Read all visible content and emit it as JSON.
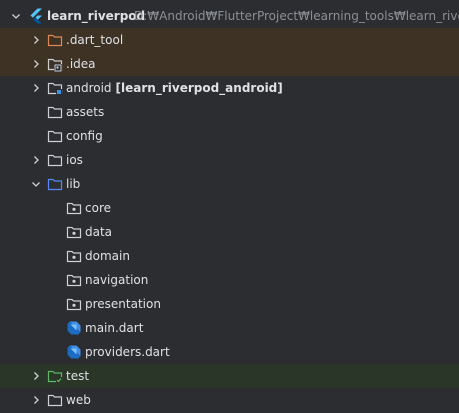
{
  "project": {
    "name": "learn_riverpod",
    "path": "D:₩Android₩FlutterProject₩learning_tools₩learn_riverpod"
  },
  "items": [
    {
      "label": ".dart_tool",
      "type": "folder-excluded"
    },
    {
      "label": ".idea",
      "type": "folder-idea"
    },
    {
      "label": "android",
      "tag": "[learn_riverpod_android]",
      "type": "folder-module"
    },
    {
      "label": "assets",
      "type": "folder"
    },
    {
      "label": "config",
      "type": "folder"
    },
    {
      "label": "ios",
      "type": "folder"
    },
    {
      "label": "lib",
      "type": "folder-source"
    },
    {
      "label": "core",
      "type": "package"
    },
    {
      "label": "data",
      "type": "package"
    },
    {
      "label": "domain",
      "type": "package"
    },
    {
      "label": "navigation",
      "type": "package"
    },
    {
      "label": "presentation",
      "type": "package"
    },
    {
      "label": "main.dart",
      "type": "dart-file"
    },
    {
      "label": "providers.dart",
      "type": "dart-file"
    },
    {
      "label": "test",
      "type": "folder-test"
    },
    {
      "label": "web",
      "type": "folder"
    }
  ],
  "colors": {
    "background": "#2b2d30",
    "excluded_row": "#3d3223",
    "test_row": "#293628",
    "text": "#dfe1e5",
    "path_text": "#8c8f94",
    "folder_outline": "#ced0d6",
    "source_folder": "#548af7",
    "excluded_folder": "#e08855",
    "test_folder": "#5fb865",
    "dart_blue": "#3f92e8"
  }
}
